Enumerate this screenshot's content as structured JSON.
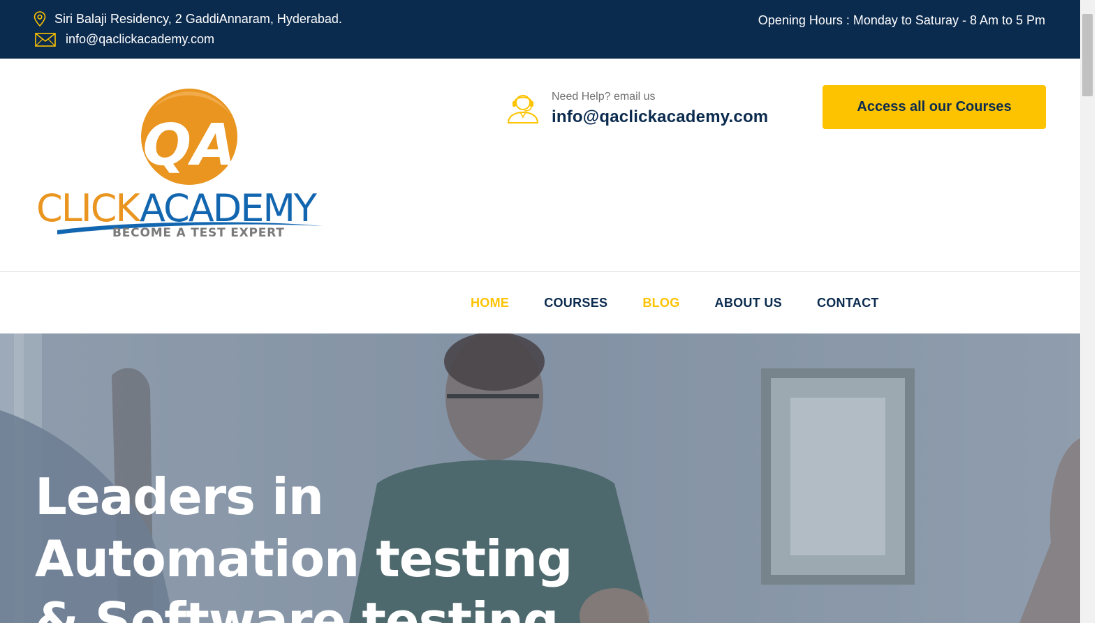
{
  "topbar": {
    "address": "Siri Balaji Residency, 2 GaddiAnnaram, Hyderabad.",
    "email": "info@qaclickacademy.com",
    "hours": "Opening Hours : Monday to Saturay - 8 Am to 5 Pm",
    "address_icon": "map-pin-icon",
    "email_icon": "envelope-icon"
  },
  "logo": {
    "badge": "QA",
    "word_click": "CLICK",
    "word_academy": "ACADEMY",
    "tagline": "BECOME A TEST EXPERT"
  },
  "help": {
    "label": "Need Help? email us",
    "email": "info@qaclickacademy.com",
    "icon": "support-agent-icon"
  },
  "cta": {
    "label": "Access all our Courses"
  },
  "nav": {
    "items": [
      {
        "label": "HOME",
        "active": true
      },
      {
        "label": "COURSES",
        "active": false
      },
      {
        "label": "BLOG",
        "active": true
      },
      {
        "label": "ABOUT US",
        "active": false
      },
      {
        "label": "CONTACT",
        "active": false
      }
    ]
  },
  "hero": {
    "line1": "Leaders in",
    "line2": "Automation testing",
    "line3": "& Software testing"
  },
  "colors": {
    "navy": "#0a2a4e",
    "accent_yellow": "#fdc300",
    "logo_orange": "#e9951f",
    "logo_blue": "#1266b0"
  }
}
